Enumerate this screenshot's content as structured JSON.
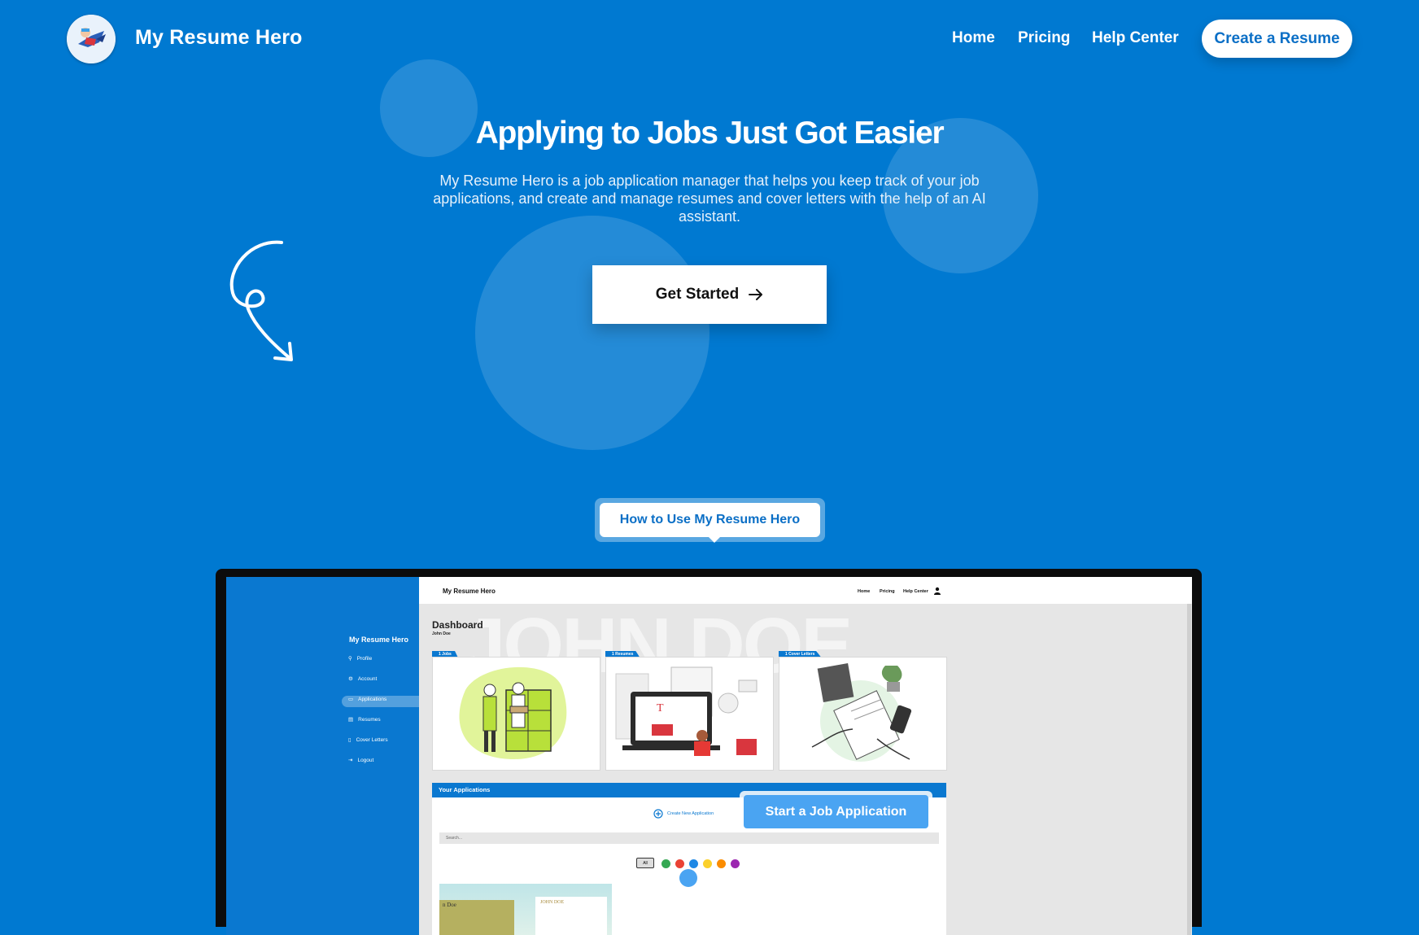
{
  "header": {
    "brand": "My Resume Hero",
    "nav": {
      "home": "Home",
      "pricing": "Pricing",
      "help": "Help Center"
    },
    "cta": "Create a Resume"
  },
  "hero": {
    "title": "Applying to Jobs Just Got Easier",
    "description": "My Resume Hero is a job application manager that helps you keep track of your job applications, and create and manage resumes and cover letters with the help of an AI assistant.",
    "button": "Get Started"
  },
  "howto": {
    "label": "How to Use My Resume Hero"
  },
  "screenshot": {
    "sidebar": {
      "brand": "My Resume Hero",
      "items": [
        "Profile",
        "Account",
        "Applications",
        "Resumes",
        "Cover Letters",
        "Logout"
      ],
      "active_index": 2
    },
    "topbar": {
      "brand": "My Resume Hero",
      "links": [
        "Home",
        "Pricing",
        "Help Center"
      ]
    },
    "dashboard": {
      "title": "Dashboard",
      "user": "John Doe",
      "bg_text": "JOHN DOE",
      "cards": [
        {
          "tag": "1  Jobs"
        },
        {
          "tag": "1  Resumes"
        },
        {
          "tag": "1  Cover Letters"
        }
      ],
      "panel_title": "Your Applications",
      "create_label": "Create New Application",
      "search_placeholder": "Search...",
      "filter_all": "All",
      "filter_colors": [
        "#35a853",
        "#ea4335",
        "#1e88e5",
        "#fbd02b",
        "#fb8c00",
        "#9c27b0"
      ],
      "resume_names": [
        "n Doe",
        "JOHN DOE"
      ],
      "tooltip": "Start a Job Application"
    }
  },
  "colors": {
    "brand_blue": "#0079d1",
    "accent_blue": "#0b6fc6",
    "white": "#ffffff"
  }
}
